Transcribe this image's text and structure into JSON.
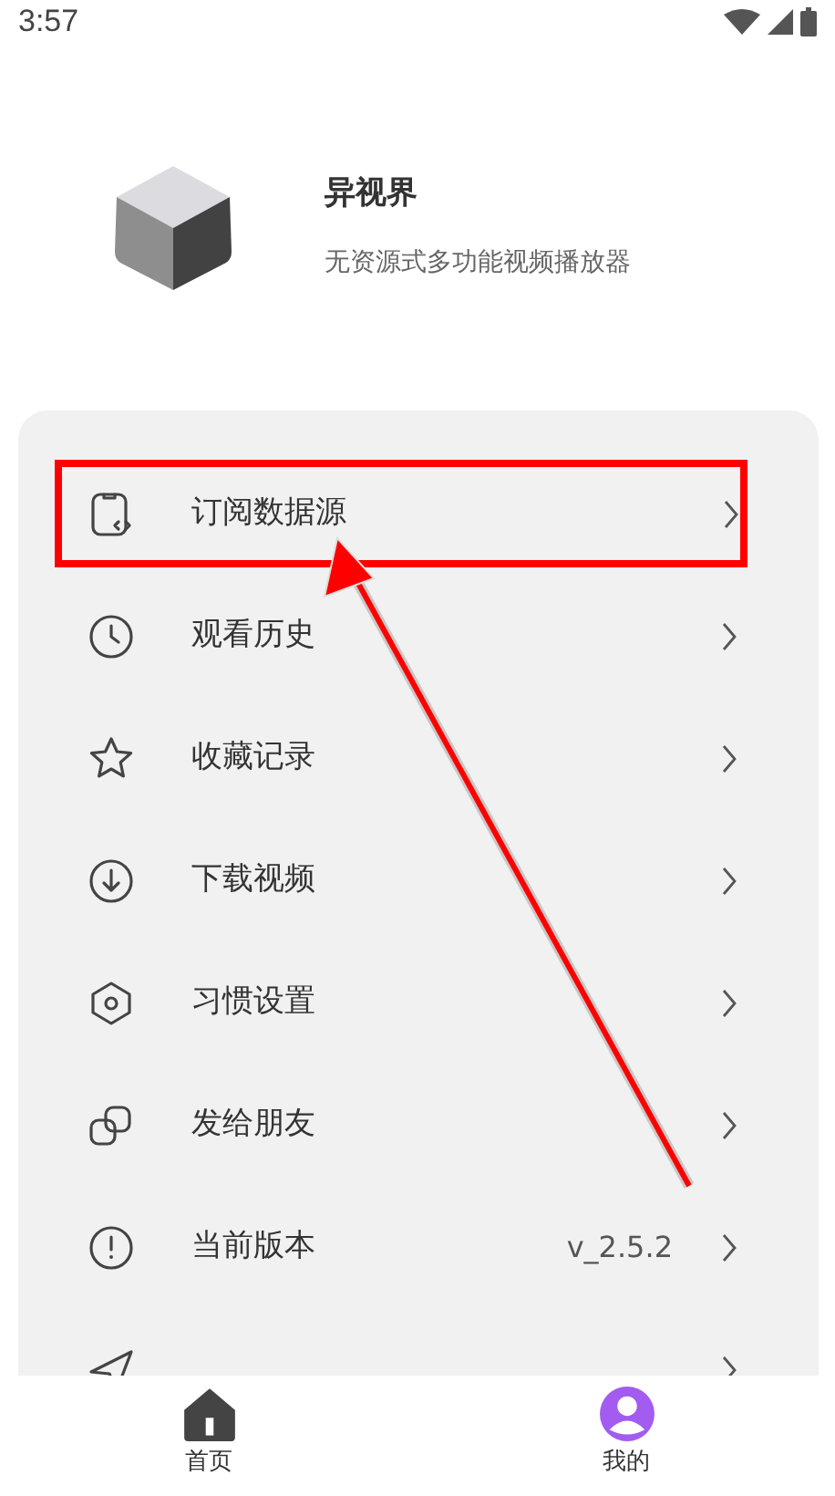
{
  "status_bar": {
    "time": "3:57"
  },
  "app": {
    "name": "异视界",
    "tagline": "无资源式多功能视频播放器"
  },
  "menu": [
    {
      "kind": "subscribe",
      "label": "订阅数据源",
      "highlighted": true
    },
    {
      "kind": "history",
      "label": "观看历史",
      "highlighted": false
    },
    {
      "kind": "star",
      "label": "收藏记录",
      "highlighted": false
    },
    {
      "kind": "download",
      "label": "下载视频",
      "highlighted": false
    },
    {
      "kind": "settings",
      "label": "习惯设置",
      "highlighted": false
    },
    {
      "kind": "share",
      "label": "发给朋友",
      "highlighted": false
    },
    {
      "kind": "info",
      "label": "当前版本",
      "value": "v_2.5.2",
      "highlighted": false
    },
    {
      "kind": "send",
      "highlighted": false
    }
  ],
  "bottom_nav": [
    {
      "kind": "home",
      "label": "首页",
      "selected": false
    },
    {
      "kind": "profile",
      "label": "我的",
      "selected": true
    }
  ]
}
